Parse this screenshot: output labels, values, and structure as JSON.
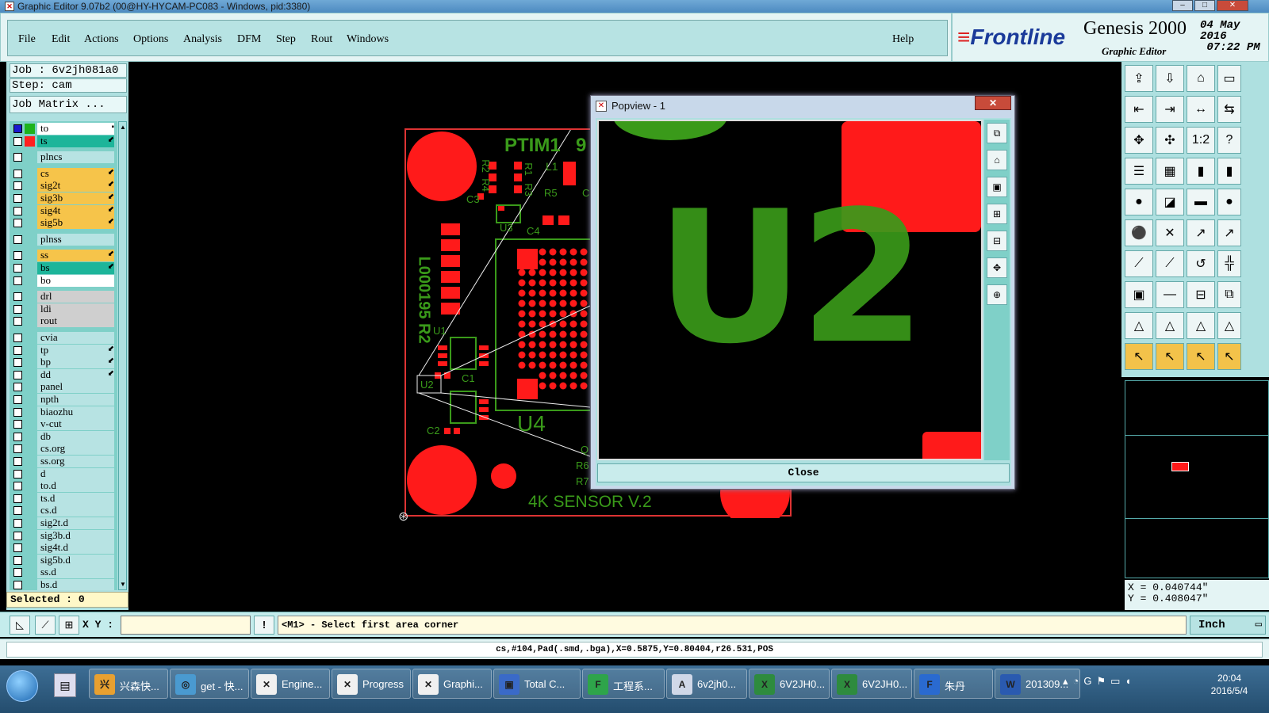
{
  "window": {
    "title": "Graphic Editor 9.07b2 (00@HY-HYCAM-PC083 - Windows, pid:3380)"
  },
  "menu": {
    "items": [
      "File",
      "Edit",
      "Actions",
      "Options",
      "Analysis",
      "DFM",
      "Step",
      "Rout",
      "Windows"
    ],
    "help": "Help"
  },
  "brand": {
    "logo": "Frontline",
    "product": "Genesis 2000",
    "subtitle": "Graphic Editor",
    "date": "04 May 2016",
    "time": "07:22 PM"
  },
  "job": {
    "job_line": "Job : 6v2jh081a0",
    "step_line": "Step: cam",
    "matrix_button": "Job Matrix ..."
  },
  "layers": [
    {
      "name": "to",
      "color": "#ffffff",
      "swatch": "#1db31d",
      "arrow": "▪"
    },
    {
      "name": "ts",
      "color": "#1db59a",
      "swatch": "#ff2020",
      "arrow": "⬋"
    },
    {
      "name": "plncs",
      "color": "#b7e3e3",
      "swatch": "",
      "arrow": ""
    },
    {
      "name": "cs",
      "color": "#f6c44a",
      "swatch": "",
      "arrow": "⬋"
    },
    {
      "name": "sig2t",
      "color": "#f6c44a",
      "swatch": "",
      "arrow": "⬋"
    },
    {
      "name": "sig3b",
      "color": "#f6c44a",
      "swatch": "",
      "arrow": "⬋"
    },
    {
      "name": "sig4t",
      "color": "#f6c44a",
      "swatch": "",
      "arrow": "⬋"
    },
    {
      "name": "sig5b",
      "color": "#f6c44a",
      "swatch": "",
      "arrow": "⬋"
    },
    {
      "name": "plnss",
      "color": "#b7e3e3",
      "swatch": "",
      "arrow": ""
    },
    {
      "name": "ss",
      "color": "#f6c44a",
      "swatch": "",
      "arrow": "⬋"
    },
    {
      "name": "bs",
      "color": "#1db59a",
      "swatch": "",
      "arrow": "⬋"
    },
    {
      "name": "bo",
      "color": "#ffffff",
      "swatch": "",
      "arrow": ""
    },
    {
      "name": "drl",
      "color": "#cfcfcf",
      "swatch": "",
      "arrow": ""
    },
    {
      "name": "ldi",
      "color": "#cfcfcf",
      "swatch": "",
      "arrow": ""
    },
    {
      "name": "rout",
      "color": "#cfcfcf",
      "swatch": "",
      "arrow": ""
    },
    {
      "name": "cvia",
      "color": "#b7e3e3",
      "swatch": "",
      "arrow": ""
    },
    {
      "name": "tp",
      "color": "#b7e3e3",
      "swatch": "",
      "arrow": "⬋"
    },
    {
      "name": "bp",
      "color": "#b7e3e3",
      "swatch": "",
      "arrow": "⬋"
    },
    {
      "name": "dd",
      "color": "#b7e3e3",
      "swatch": "",
      "arrow": "⬋"
    },
    {
      "name": "panel",
      "color": "#b7e3e3",
      "swatch": "",
      "arrow": ""
    },
    {
      "name": "npth",
      "color": "#b7e3e3",
      "swatch": "",
      "arrow": ""
    },
    {
      "name": "biaozhu",
      "color": "#b7e3e3",
      "swatch": "",
      "arrow": ""
    },
    {
      "name": "v-cut",
      "color": "#b7e3e3",
      "swatch": "",
      "arrow": ""
    },
    {
      "name": "db",
      "color": "#b7e3e3",
      "swatch": "",
      "arrow": ""
    },
    {
      "name": "cs.org",
      "color": "#b7e3e3",
      "swatch": "",
      "arrow": ""
    },
    {
      "name": "ss.org",
      "color": "#b7e3e3",
      "swatch": "",
      "arrow": ""
    },
    {
      "name": "d",
      "color": "#b7e3e3",
      "swatch": "",
      "arrow": ""
    },
    {
      "name": "to.d",
      "color": "#b7e3e3",
      "swatch": "",
      "arrow": ""
    },
    {
      "name": "ts.d",
      "color": "#b7e3e3",
      "swatch": "",
      "arrow": ""
    },
    {
      "name": "cs.d",
      "color": "#b7e3e3",
      "swatch": "",
      "arrow": ""
    },
    {
      "name": "sig2t.d",
      "color": "#b7e3e3",
      "swatch": "",
      "arrow": ""
    },
    {
      "name": "sig3b.d",
      "color": "#b7e3e3",
      "swatch": "",
      "arrow": ""
    },
    {
      "name": "sig4t.d",
      "color": "#b7e3e3",
      "swatch": "",
      "arrow": ""
    },
    {
      "name": "sig5b.d",
      "color": "#b7e3e3",
      "swatch": "",
      "arrow": ""
    },
    {
      "name": "ss.d",
      "color": "#b7e3e3",
      "swatch": "",
      "arrow": ""
    },
    {
      "name": "bs.d",
      "color": "#b7e3e3",
      "swatch": "",
      "arrow": ""
    }
  ],
  "selected": "Selected : 0",
  "board": {
    "title": "PTIM1",
    "title_tail": "9",
    "part_number": "L000195 R2",
    "footer": "4K SENSOR V.2",
    "labels": [
      "R2",
      "R4",
      "R1",
      "R3",
      "L1",
      "R5",
      "C3",
      "U3",
      "C4",
      "U1",
      "C1",
      "U2",
      "C2",
      "U4",
      "Q",
      "R6",
      "R7",
      "C"
    ]
  },
  "popview": {
    "title": "Popview - 1",
    "zoom_label": "U2",
    "close_label": "Close"
  },
  "coords": {
    "x": "X = 0.040744\"",
    "y": "Y = 0.408047\""
  },
  "bottom": {
    "xy_label": "X Y :",
    "xy_value": "",
    "prompt": "<M1> - Select first area corner",
    "unit": "Inch"
  },
  "status": "cs,#104,Pad(.smd,.bga),X=0.5875,Y=0.80404,r26.531,POS",
  "taskbar": {
    "items": [
      {
        "label": "兴森快...",
        "icon": "兴",
        "color": "#e8a030"
      },
      {
        "label": "get - 快...",
        "icon": "◎",
        "color": "#4a9ad0"
      },
      {
        "label": "Engine...",
        "icon": "✕",
        "color": "#f0f0f0"
      },
      {
        "label": "Progress",
        "icon": "✕",
        "color": "#f0f0f0"
      },
      {
        "label": "Graphi...",
        "icon": "✕",
        "color": "#f0f0f0"
      },
      {
        "label": "Total C...",
        "icon": "▣",
        "color": "#3a6ac8"
      },
      {
        "label": "工程系...",
        "icon": "F",
        "color": "#2ea44a"
      },
      {
        "label": "6v2jh0...",
        "icon": "A",
        "color": "#d0d8e8"
      },
      {
        "label": "6V2JH0...",
        "icon": "X",
        "color": "#2e8b3e"
      },
      {
        "label": "6V2JH0...",
        "icon": "X",
        "color": "#2e8b3e"
      },
      {
        "label": "朱丹",
        "icon": "F",
        "color": "#2a6ad0"
      },
      {
        "label": "201309...",
        "icon": "W",
        "color": "#2a5ab0"
      }
    ],
    "time": "20:04",
    "date": "2016/5/4"
  }
}
